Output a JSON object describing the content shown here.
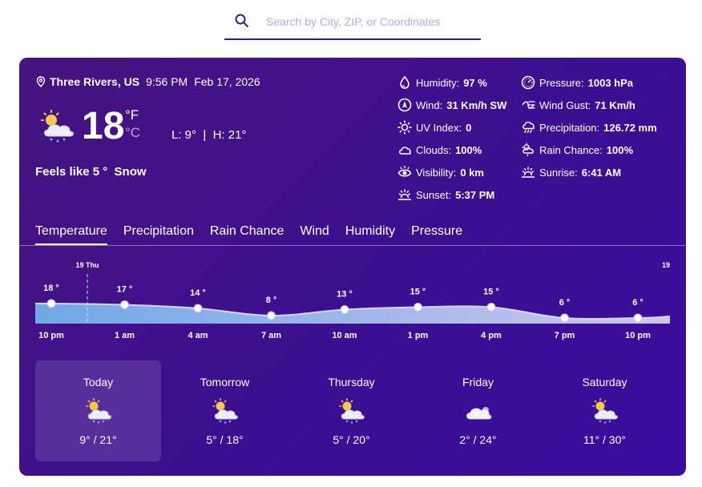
{
  "search": {
    "placeholder": "Search by City, ZIP, or Coordinates"
  },
  "location": {
    "name": "Three Rivers, US",
    "time": "9:56 PM",
    "date": "Feb 17, 2026"
  },
  "current": {
    "temp": "18",
    "unit_f": "°F",
    "unit_c": "°C",
    "low_high": "L: 9°  |  H: 21°",
    "feels_like": "Feels like 5 °  Snow",
    "icon": "partly-cloudy-snow-icon"
  },
  "details": {
    "humidity": {
      "label": "Humidity:",
      "value": "97 %"
    },
    "wind": {
      "label": "Wind:",
      "value": "31 Km/h SW"
    },
    "uv": {
      "label": "UV Index:",
      "value": "0"
    },
    "clouds": {
      "label": "Clouds:",
      "value": "100%"
    },
    "visibility": {
      "label": "Visibility:",
      "value": "0 km"
    },
    "sunset": {
      "label": "Sunset:",
      "value": "5:37 PM"
    },
    "pressure": {
      "label": "Pressure:",
      "value": "1003 hPa"
    },
    "gust": {
      "label": "Wind Gust:",
      "value": "71 Km/h"
    },
    "precip": {
      "label": "Precipitation:",
      "value": "126.72 mm"
    },
    "rain": {
      "label": "Rain Chance:",
      "value": "100%"
    },
    "sunrise": {
      "label": "Sunrise:",
      "value": "6:41 AM"
    }
  },
  "tabs": [
    "Temperature",
    "Precipitation",
    "Rain Chance",
    "Wind",
    "Humidity",
    "Pressure"
  ],
  "active_tab": "Temperature",
  "chart_data": {
    "type": "area",
    "x": [
      "10 pm",
      "1 am",
      "4 am",
      "7 am",
      "10 am",
      "1 pm",
      "4 pm",
      "7 pm",
      "10 pm"
    ],
    "values": [
      18,
      17,
      14,
      8,
      13,
      15,
      15,
      6,
      6
    ],
    "value_labels": [
      "18 °",
      "17 °",
      "14 °",
      "8 °",
      "13 °",
      "15 °",
      "15 °",
      "6 °",
      "6 °"
    ],
    "day_markers": [
      "19 Thu",
      "19"
    ],
    "colors": {
      "fill_start": "#6fa8e6",
      "fill_end": "#cfc6ee",
      "line": "#d9d3f2",
      "point": "#ffffff"
    }
  },
  "forecast": [
    {
      "day": "Today",
      "range": "9° / 21°",
      "icon": "partly-cloudy-snow-icon"
    },
    {
      "day": "Tomorrow",
      "range": "5° / 18°",
      "icon": "partly-cloudy-snow-icon"
    },
    {
      "day": "Thursday",
      "range": "5° / 20°",
      "icon": "partly-cloudy-snow-icon"
    },
    {
      "day": "Friday",
      "range": "2° / 24°",
      "icon": "cloud-icon"
    },
    {
      "day": "Saturday",
      "range": "11° / 30°",
      "icon": "partly-cloudy-snow-icon"
    }
  ]
}
